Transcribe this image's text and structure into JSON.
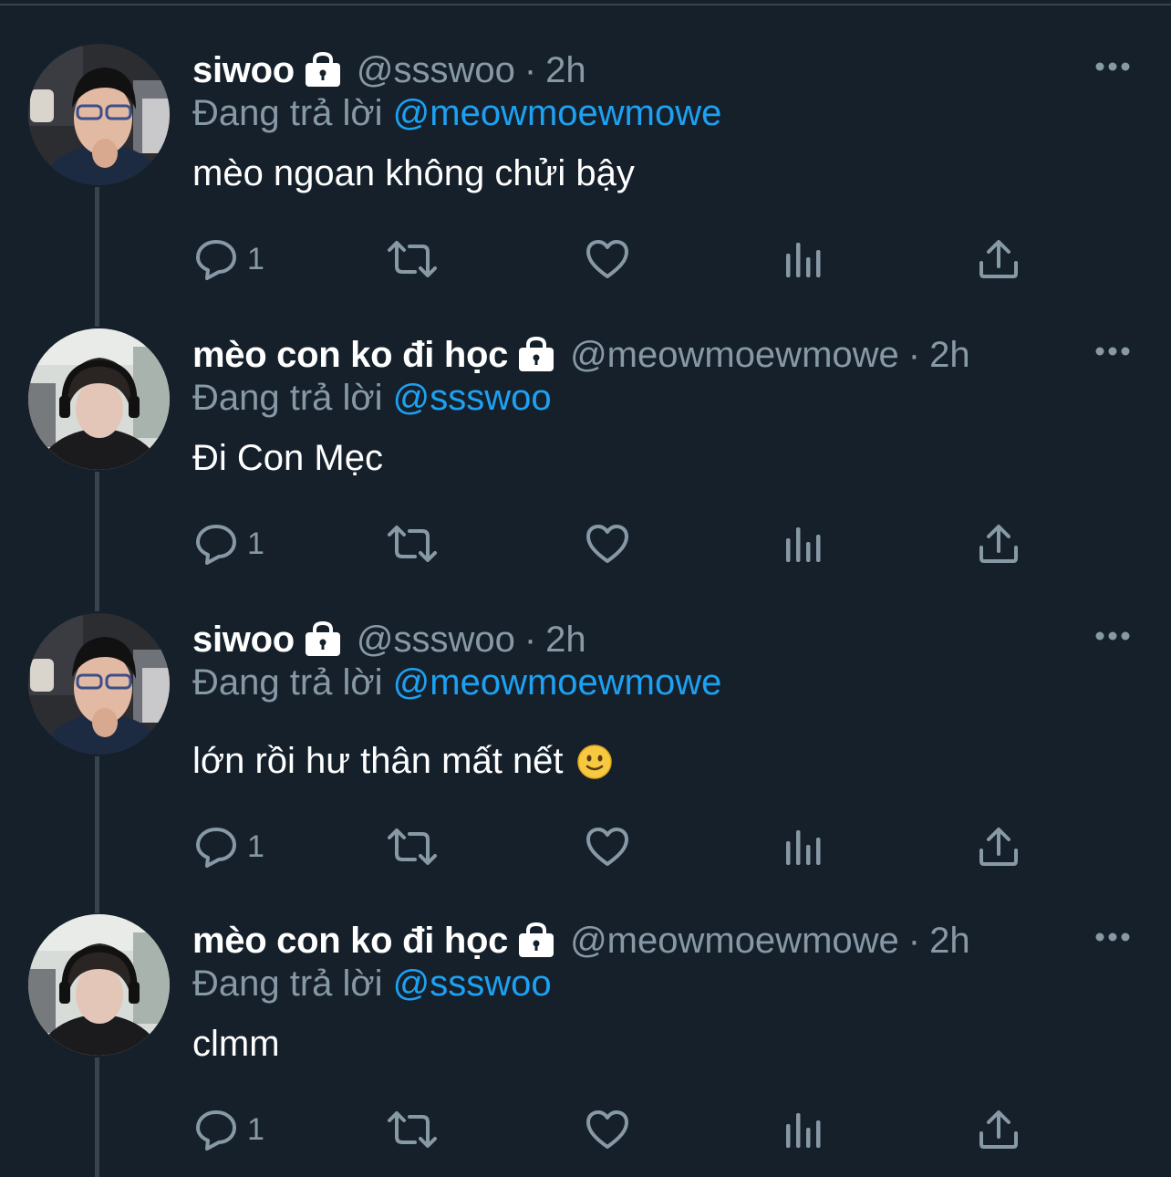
{
  "colors": {
    "background": "#15202b",
    "secondary_text": "#8899a6",
    "mention": "#1da1f2",
    "thread_line": "#38444d"
  },
  "tweets": [
    {
      "display_name": "siwoo",
      "handle": "@ssswoo",
      "separator": "·",
      "time": "2h",
      "reply_prefix": "Đang trả lời",
      "reply_to": "@meowmoewmowe",
      "text": "mèo ngoan không chửi bậy",
      "reply_count": "1",
      "avatar": "avatar-siwoo"
    },
    {
      "display_name": "mèo con ko đi học",
      "handle": "@meowmoewmowe",
      "separator": "·",
      "time": "2h",
      "reply_prefix": "Đang trả lời",
      "reply_to": "@ssswoo",
      "text": "Đi Con Mẹc",
      "reply_count": "1",
      "avatar": "avatar-meo"
    },
    {
      "display_name": "siwoo",
      "handle": "@ssswoo",
      "separator": "·",
      "time": "2h",
      "reply_prefix": "Đang trả lời",
      "reply_to": "@meowmoewmowe",
      "text": "lớn rồi hư thân mất nết",
      "emoji": "slightly-smiling-face-icon",
      "reply_count": "1",
      "avatar": "avatar-siwoo"
    },
    {
      "display_name": "mèo con ko đi học",
      "handle": "@meowmoewmowe",
      "separator": "·",
      "time": "2h",
      "reply_prefix": "Đang trả lời",
      "reply_to": "@ssswoo",
      "text": "clmm",
      "reply_count": "1",
      "avatar": "avatar-meo"
    }
  ]
}
